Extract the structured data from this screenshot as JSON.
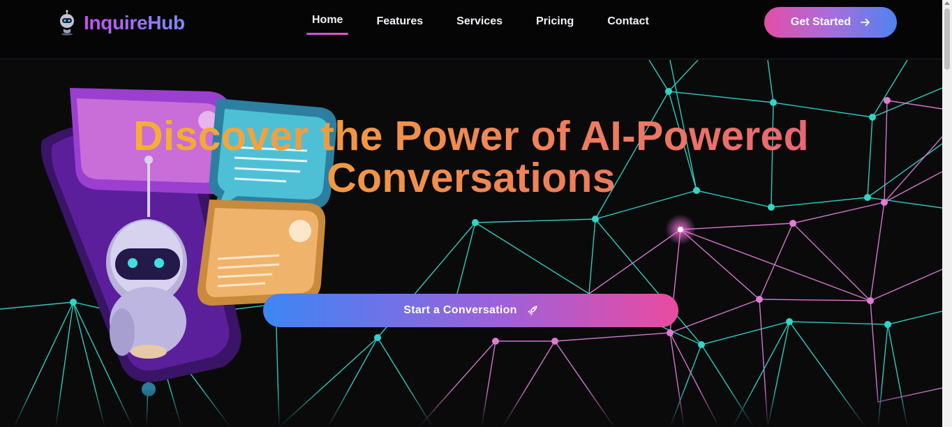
{
  "brand": {
    "name": "InquireHub",
    "icon": "robot-head-icon"
  },
  "nav": {
    "items": [
      {
        "label": "Home",
        "active": true
      },
      {
        "label": "Features",
        "active": false
      },
      {
        "label": "Services",
        "active": false
      },
      {
        "label": "Pricing",
        "active": false
      },
      {
        "label": "Contact",
        "active": false
      }
    ],
    "cta_label": "Get Started",
    "cta_icon": "arrow-right-icon"
  },
  "hero": {
    "headline_line1": "Discover the Power of AI-Powered",
    "headline_line2": "Conversations",
    "button_label": "Start a Conversation",
    "button_icon": "rocket-icon",
    "illustration": "robot-chat-phone-illustration",
    "background": "network-mesh-graphic"
  },
  "colors": {
    "background": "#0a0a0b",
    "brand_gradient": [
      "#c450f0",
      "#7e8cf5"
    ],
    "headline_gradient": [
      "#f6c12a",
      "#e65880"
    ],
    "cta_gradient": [
      "#e44ea6",
      "#4f83f0"
    ],
    "mesh_cyan": "#2fd6c8",
    "mesh_pink": "#e07bd8"
  }
}
